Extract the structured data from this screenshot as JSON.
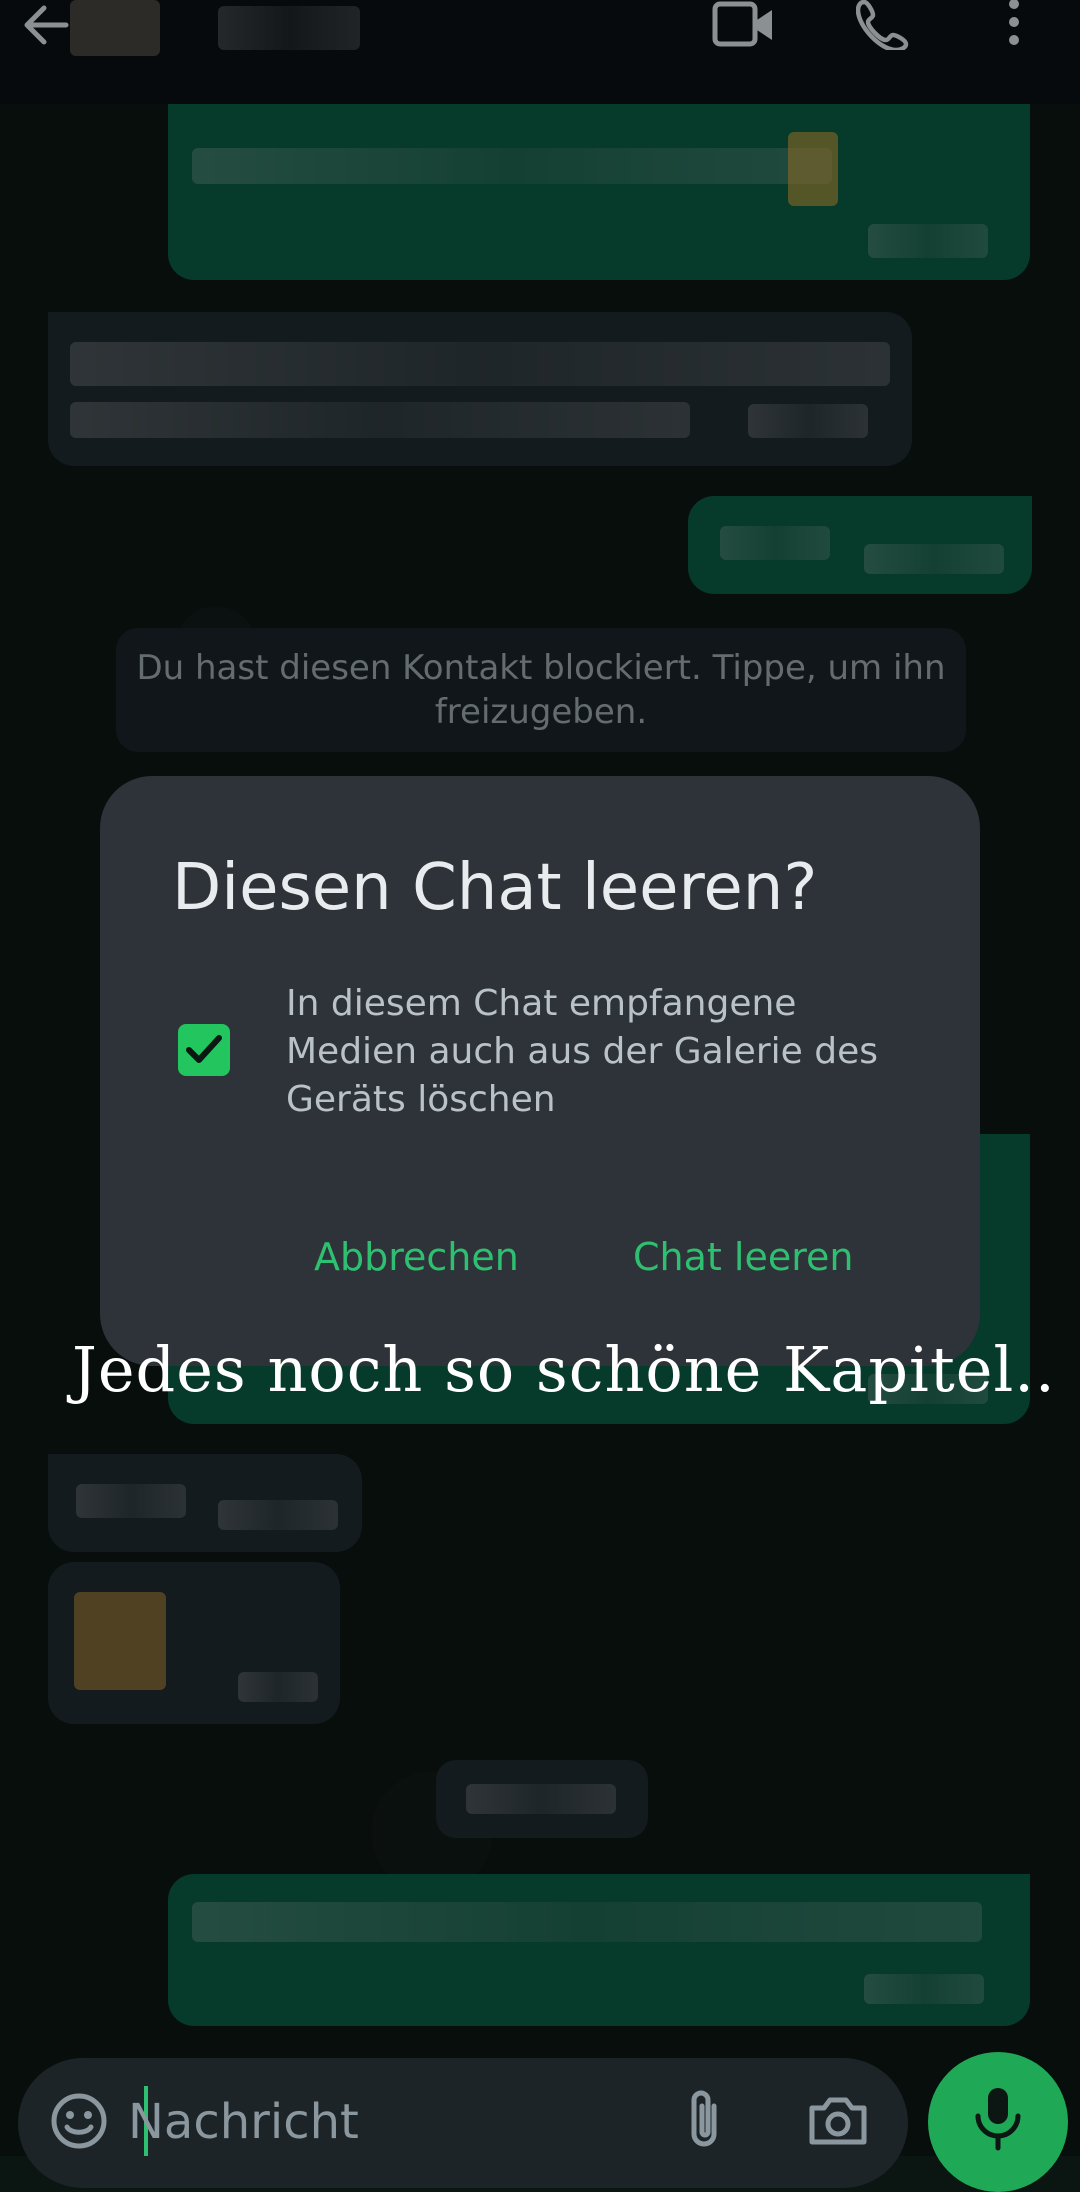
{
  "header": {
    "back_icon": "arrow-left-icon",
    "video_icon": "video-camera-icon",
    "call_icon": "phone-icon",
    "menu_icon": "more-vertical-icon"
  },
  "chat": {
    "blocked_notice": "Du hast diesen Kontakt blockiert. Tippe, um ihn freizugeben."
  },
  "dialog": {
    "title": "Diesen Chat leeren?",
    "checkbox_checked": true,
    "checkbox_label": "In diesem Chat empfangene Medien auch aus der Galerie des Geräts löschen",
    "cancel_label": "Abbrechen",
    "confirm_label": "Chat leeren"
  },
  "overlay": {
    "caption": "Jedes noch so schöne Kapitel.."
  },
  "composer": {
    "placeholder": "Nachricht",
    "emoji_icon": "emoji-icon",
    "attach_icon": "paperclip-icon",
    "camera_icon": "camera-icon",
    "mic_icon": "microphone-icon"
  },
  "colors": {
    "accent": "#22c55e",
    "outgoing_bubble": "#0a5a43",
    "incoming_bubble": "#1e2a30",
    "dialog_bg": "#2d3338"
  }
}
